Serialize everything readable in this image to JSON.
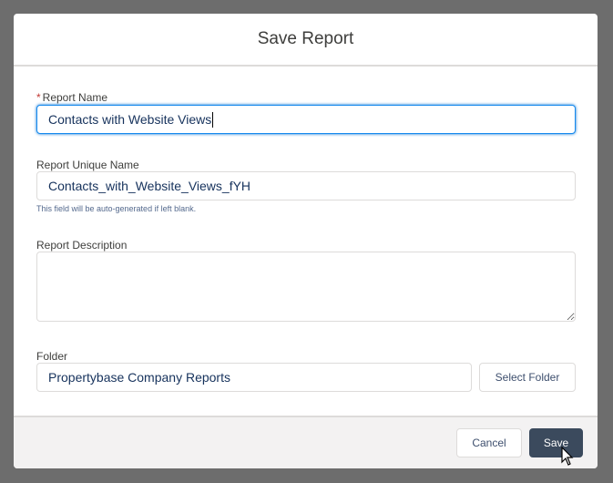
{
  "dialog": {
    "title": "Save Report"
  },
  "fields": {
    "report_name": {
      "required_marker": "*",
      "label": "Report Name",
      "value": "Contacts with Website Views"
    },
    "unique_name": {
      "label": "Report Unique Name",
      "value": "Contacts_with_Website_Views_fYH",
      "help": "This field will be auto-generated if left blank."
    },
    "description": {
      "label": "Report Description",
      "value": ""
    },
    "folder": {
      "label": "Folder",
      "value": "Propertybase Company Reports",
      "select_label": "Select Folder"
    }
  },
  "footer": {
    "cancel_label": "Cancel",
    "save_label": "Save"
  }
}
